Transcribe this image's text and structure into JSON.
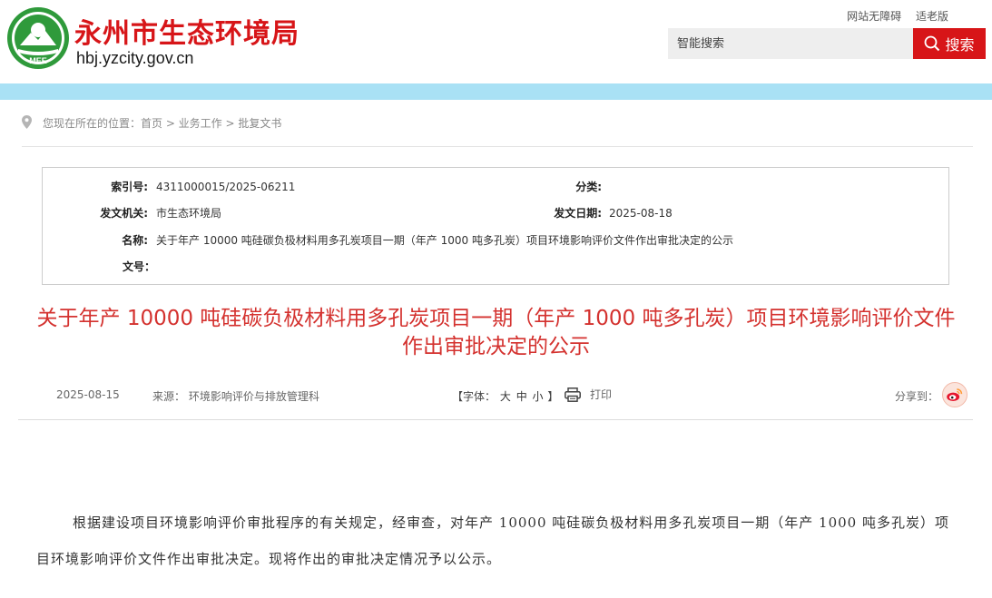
{
  "header": {
    "site_name": "永州市生态环境局",
    "domain": "hbj.yzcity.gov.cn",
    "emblem_text": "MEE",
    "links": [
      "网站无障碍",
      "适老版"
    ],
    "search_placeholder": "智能搜索",
    "search_button": "搜索"
  },
  "breadcrumb": "您现在所在的位置：首页 > 业务工作 > 批复文书",
  "info": {
    "index_label": "索引号:",
    "index_value": "4311000015/2025-06211",
    "category_label": "分类:",
    "category_value": "",
    "issuer_label": "发文机关:",
    "issuer_value": "市生态环境局",
    "date_label": "发文日期:",
    "date_value": "2025-08-18",
    "name_label": "名称:",
    "name_value": "关于年产 10000 吨硅碳负极材料用多孔炭项目一期（年产 1000 吨多孔炭）项目环境影响评价文件作出审批决定的公示",
    "docno_label": "文号：",
    "docno_value": ""
  },
  "article": {
    "title_line1": "关于年产 10000 吨硅碳负极材料用多孔炭项目一期（年产 1000 吨多孔炭）项目环境影响评价文件",
    "title_line2": "作出审批决定的公示",
    "date": "2025-08-15",
    "source": "来源：  环境影响评价与排放管理科",
    "font_label": "【字体：",
    "font_large": "大",
    "font_medium": "中",
    "font_small": "小",
    "font_close": "】",
    "print": "打印",
    "share": "分享到：",
    "paragraph": "根据建设项目环境影响评价审批程序的有关规定，经审查，对年产 10000 吨硅碳负极材料用多孔炭项目一期（年产 1000 吨多孔炭）项目环境影响评价文件作出审批决定。现将作出的审批决定情况予以公示。"
  },
  "colors": {
    "brand_red": "#d71518",
    "title_red": "#d4322f",
    "band": "#a9e1f5",
    "emblem_green": "#2f9a3b"
  }
}
